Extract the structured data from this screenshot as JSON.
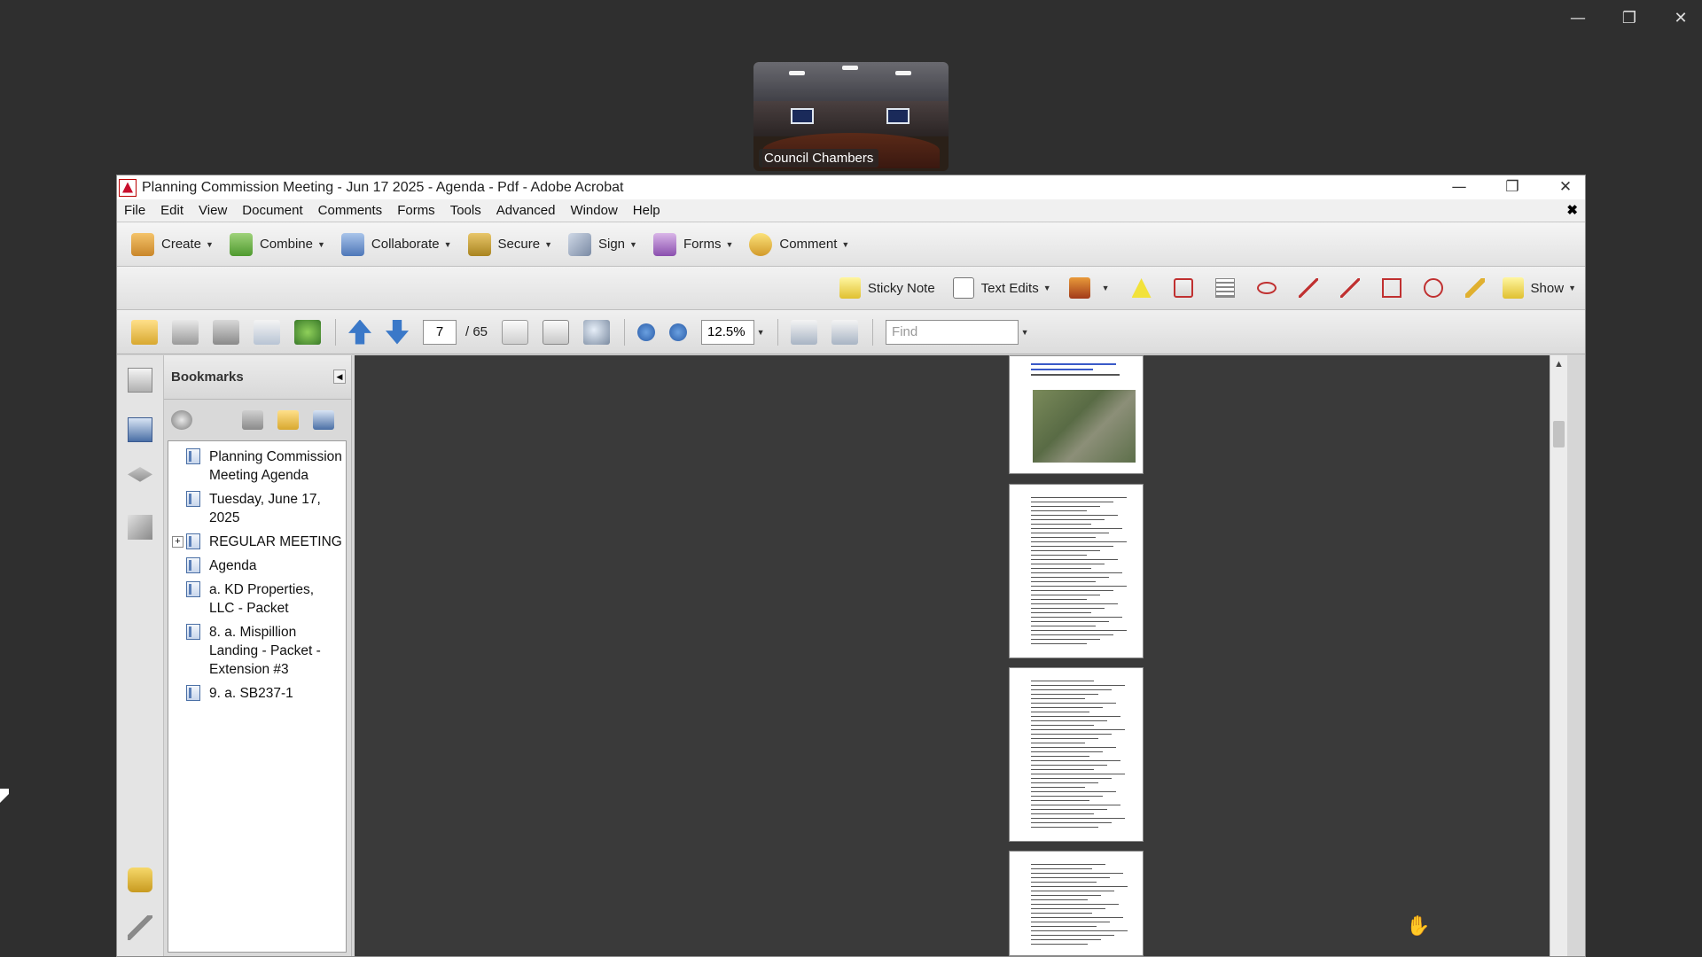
{
  "outer_window": {
    "minimize": "—",
    "restore": "❐",
    "close": "✕"
  },
  "camera": {
    "label": "Council Chambers"
  },
  "window": {
    "title": "Planning Commission Meeting - Jun 17 2025 - Agenda - Pdf - Adobe Acrobat",
    "minimize": "—",
    "restore": "❐",
    "close": "✕"
  },
  "menu": [
    "File",
    "Edit",
    "View",
    "Document",
    "Comments",
    "Forms",
    "Tools",
    "Advanced",
    "Window",
    "Help"
  ],
  "menu_close": "✖",
  "toolbar1": {
    "create": "Create",
    "combine": "Combine",
    "collaborate": "Collaborate",
    "secure": "Secure",
    "sign": "Sign",
    "forms": "Forms",
    "comment": "Comment"
  },
  "toolbar2": {
    "sticky_note": "Sticky Note",
    "text_edits": "Text Edits",
    "show": "Show"
  },
  "toolbar3": {
    "page_current": "7",
    "page_total": "/ 65",
    "zoom": "12.5%",
    "find_placeholder": "Find"
  },
  "bookmarks": {
    "title": "Bookmarks",
    "items": [
      {
        "label": "Planning Commission Meeting Agenda",
        "expandable": false
      },
      {
        "label": "Tuesday, June 17, 2025",
        "expandable": false
      },
      {
        "label": "REGULAR MEETING",
        "expandable": true
      },
      {
        "label": "Agenda",
        "expandable": false
      },
      {
        "label": "a. KD Properties, LLC - Packet",
        "expandable": false
      },
      {
        "label": "8. a. Mispillion Landing - Packet - Extension #3",
        "expandable": false
      },
      {
        "label": "9. a. SB237-1",
        "expandable": false
      }
    ]
  },
  "colors": {
    "acrobat_red": "#c8102e",
    "toolbar_bg": "#e4e4e4",
    "doc_bg": "#3a3a3a"
  }
}
